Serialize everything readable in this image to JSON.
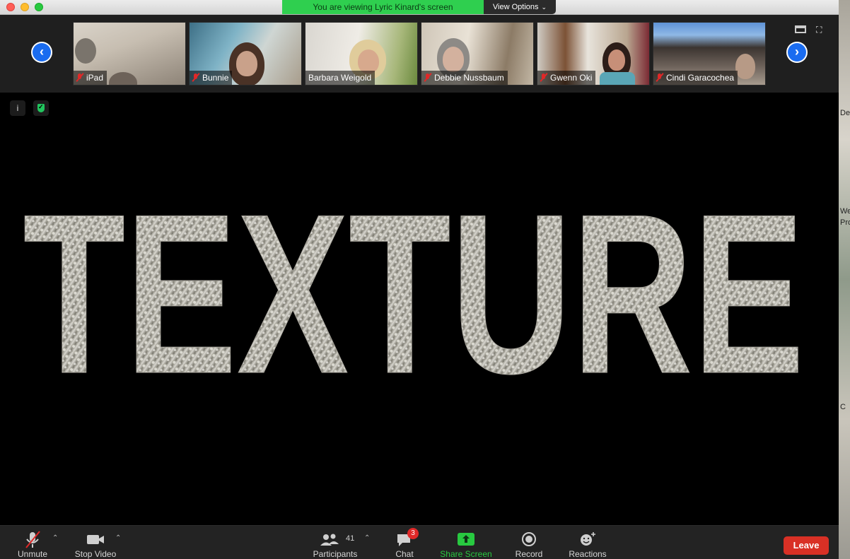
{
  "window": {
    "viewing_banner": "You are viewing Lyric Kinard's screen",
    "view_options": "View Options"
  },
  "participants_strip": {
    "tiles": [
      {
        "name": "iPad",
        "muted": true
      },
      {
        "name": "Bunnie",
        "muted": true
      },
      {
        "name": "Barbara Weigold",
        "muted": false
      },
      {
        "name": "Debbie Nussbaum",
        "muted": true
      },
      {
        "name": "Gwenn Oki",
        "muted": true
      },
      {
        "name": "Cindi Garacochea",
        "muted": true
      }
    ],
    "prev_arrow": "‹",
    "next_arrow": "›"
  },
  "shared_screen": {
    "text": "TEXTURE",
    "info_glyph": "i"
  },
  "toolbar": {
    "unmute": "Unmute",
    "stop_video": "Stop Video",
    "participants": "Participants",
    "participants_count": "41",
    "chat": "Chat",
    "chat_unread": "3",
    "share_screen": "Share Screen",
    "record": "Record",
    "reactions": "Reactions",
    "leave": "Leave"
  },
  "desktop_fragments": [
    "De C",
    "We",
    "Pro",
    "C"
  ],
  "colors": {
    "banner_green": "#2fcf4f",
    "nav_blue": "#1a6cf0",
    "leave_red": "#d93025",
    "share_green": "#28c940",
    "mute_red": "#e02828"
  }
}
